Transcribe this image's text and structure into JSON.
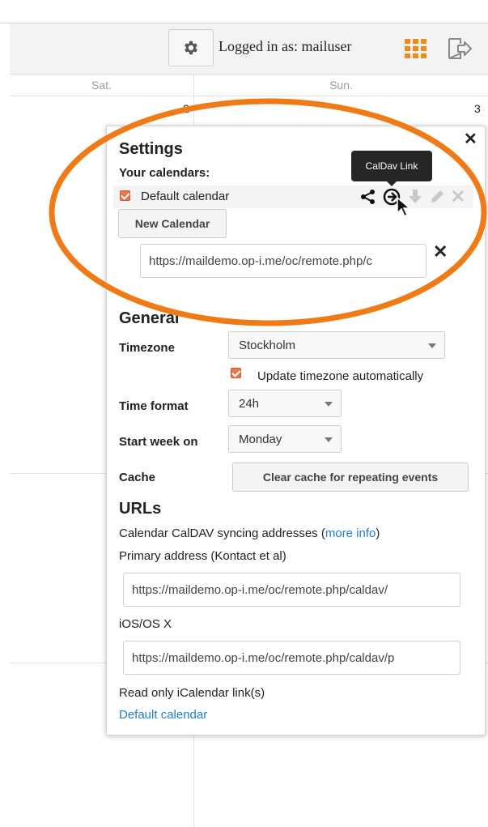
{
  "header": {
    "login_text": "Logged in as: mailuser"
  },
  "calendar": {
    "day_headers": [
      "Sat.",
      "Sun."
    ],
    "day_numbers": [
      "2",
      "3"
    ]
  },
  "settings": {
    "title": "Settings",
    "your_calendars_label": "Your calendars:",
    "calendar_name": "Default calendar",
    "tooltip": "CalDav Link",
    "new_calendar_button": "New Calendar",
    "caldav_link_value": "https://maildemo.op-i.me/oc/remote.php/c",
    "general_title": "General",
    "timezone_label": "Timezone",
    "timezone_value": "Stockholm",
    "update_timezone_label": "Update timezone automatically",
    "time_format_label": "Time format",
    "time_format_value": "24h",
    "start_week_label": "Start week on",
    "start_week_value": "Monday",
    "cache_label": "Cache",
    "clear_cache_button": "Clear cache for repeating events",
    "urls_title": "URLs",
    "caldav_sync_text": "Calendar CalDAV syncing addresses (",
    "more_info_link": "more info",
    "caldav_sync_close": ")",
    "primary_address_label": "Primary address (Kontact et al)",
    "primary_address_value": "https://maildemo.op-i.me/oc/remote.php/caldav/",
    "ios_label": "iOS/OS X",
    "ios_value": "https://maildemo.op-i.me/oc/remote.php/caldav/p",
    "readonly_label": "Read only iCalendar link(s)",
    "readonly_link": "Default calendar"
  },
  "colors": {
    "accent_orange": "#f07a16",
    "checkbox": "#e8784a",
    "link": "#1d7fd0",
    "apps_icon": "#f28a1a"
  },
  "icons": {
    "header": [
      "gear-icon",
      "apps-grid-icon",
      "logout-icon"
    ],
    "calendar_actions": [
      "share-icon",
      "caldav-link-icon",
      "download-icon",
      "edit-icon",
      "delete-icon"
    ]
  }
}
